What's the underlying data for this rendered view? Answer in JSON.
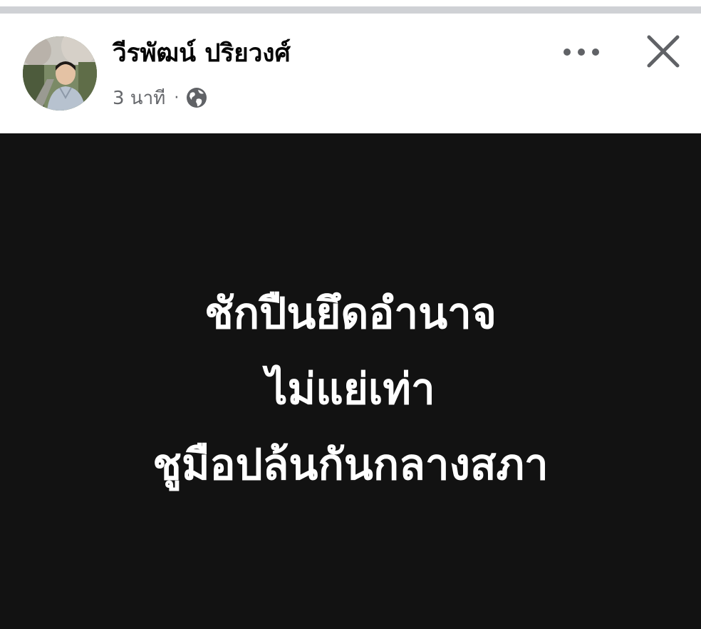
{
  "post": {
    "author_name": "วีรพัฒน์ ปริยวงศ์",
    "timestamp": "3 นาที",
    "separator": "·",
    "privacy_icon": "globe-icon",
    "more_icon": "more-horizontal-icon",
    "close_icon": "close-icon",
    "image_text": {
      "line1": "ชักปืนยึดอำนาจ",
      "line2": "ไม่แย่เท่า",
      "line3": "ชูมือปล้นกันกลางสภา"
    }
  },
  "colors": {
    "header_bg": "#ffffff",
    "name_text": "#050505",
    "meta_text": "#65676b",
    "icon_dark": "#606266",
    "image_bg": "#121212",
    "image_text": "#ffffff"
  }
}
